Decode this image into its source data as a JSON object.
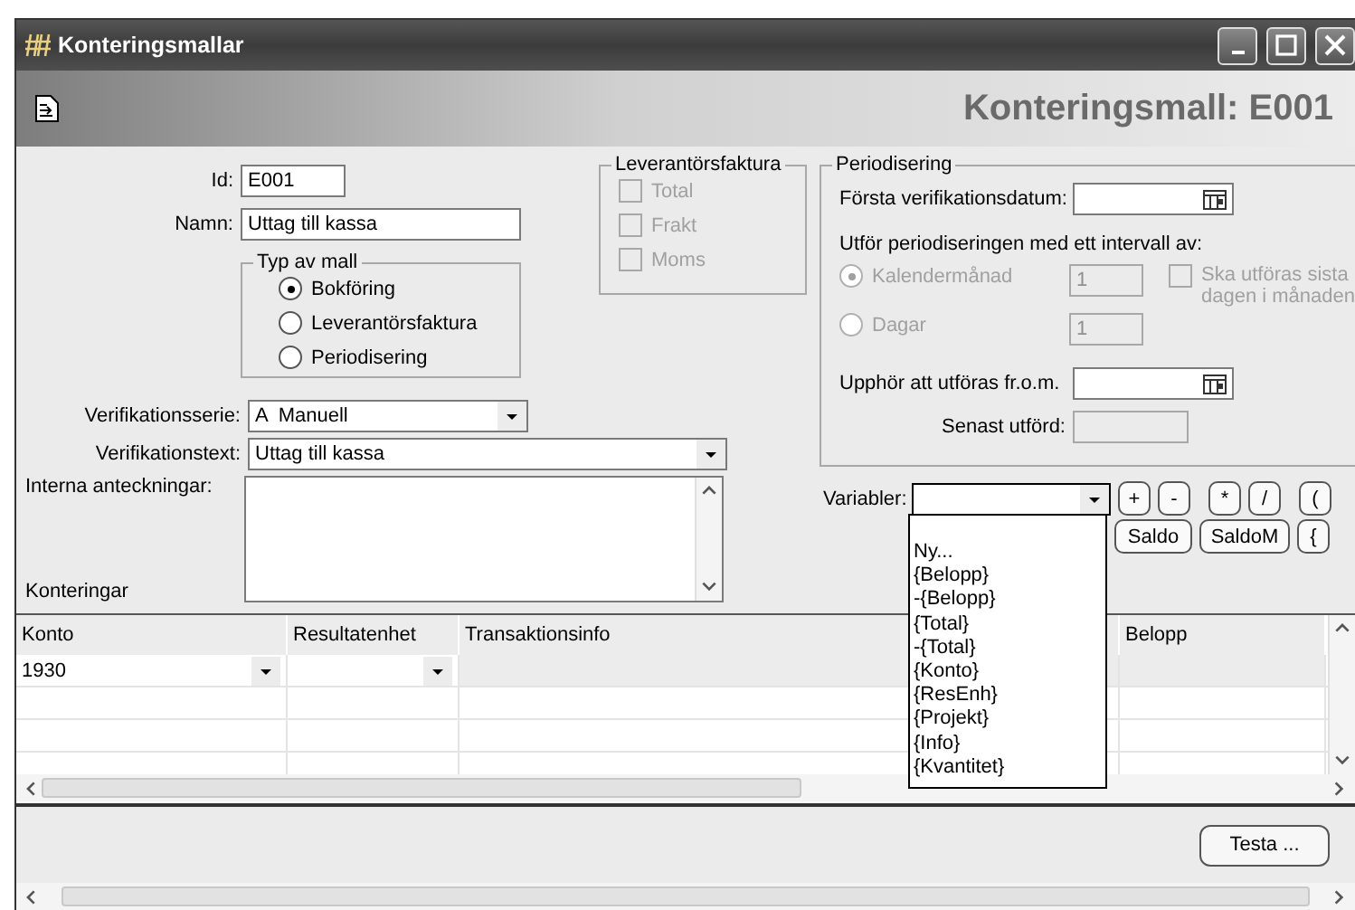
{
  "window": {
    "title": "Konteringsmallar"
  },
  "header": {
    "heading": "Konteringsmall: E001"
  },
  "form": {
    "id": {
      "label": "Id:",
      "value": "E001"
    },
    "name": {
      "label": "Namn:",
      "value": "Uttag till kassa"
    },
    "template_type": {
      "legend": "Typ av mall",
      "options": [
        {
          "label": "Bokföring",
          "selected": true
        },
        {
          "label": "Leverantörsfaktura",
          "selected": false
        },
        {
          "label": "Periodisering",
          "selected": false
        }
      ]
    },
    "series": {
      "label": "Verifikationsserie:",
      "value": "A  Manuell"
    },
    "text": {
      "label": "Verifikationstext:",
      "value": "Uttag till kassa"
    },
    "notes": {
      "label": "Interna anteckningar:"
    },
    "postings_label": "Konteringar"
  },
  "supplier_invoice": {
    "legend": "Leverantörsfaktura",
    "disabled": true,
    "options": [
      {
        "label": "Total",
        "checked": false
      },
      {
        "label": "Frakt",
        "checked": false
      },
      {
        "label": "Moms",
        "checked": false
      }
    ]
  },
  "accrual": {
    "legend": "Periodisering",
    "first_date": {
      "label": "Första verifikationsdatum:"
    },
    "interval_label": "Utför periodiseringen med ett intervall av:",
    "disabled": true,
    "intervals": [
      {
        "label": "Kalendermånad",
        "selected": true,
        "value": "1"
      },
      {
        "label": "Dagar",
        "selected": false,
        "value": "1"
      }
    ],
    "last_day": {
      "label": "Ska utföras sista dagen i månaden",
      "checked": false
    },
    "end_date": {
      "label": "Upphör att utföras fr.o.m."
    },
    "last_run": {
      "label": "Senast utförd:"
    }
  },
  "variables": {
    "label": "Variabler:",
    "expanded": true,
    "items": [
      "Ny...",
      "{Belopp}",
      "-{Belopp}",
      "{Total}",
      "-{Total}",
      "{Konto}",
      "{ResEnh}",
      "{Projekt}",
      "{Info}",
      "{Kvantitet}"
    ],
    "operators": [
      "+",
      "-",
      "*",
      "/",
      "("
    ],
    "functions": [
      "Saldo",
      "SaldoM",
      "{"
    ]
  },
  "table": {
    "columns": [
      {
        "label": "Konto",
        "kind": "combo"
      },
      {
        "label": "Resultatenhet",
        "kind": "combo"
      },
      {
        "label": "Transaktionsinfo",
        "kind": "text"
      },
      {
        "label": "Belopp",
        "kind": "text"
      }
    ],
    "rows": [
      {
        "cells": [
          "1930"
        ],
        "selected": true
      }
    ]
  },
  "footer": {
    "test_button": "Testa ..."
  }
}
